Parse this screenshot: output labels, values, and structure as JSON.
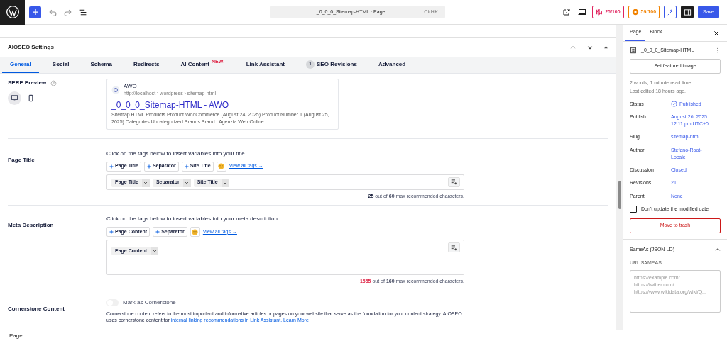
{
  "topbar": {
    "document_title": "_0_0_0_Sitemap-HTML · Page",
    "shortcut": "Ctrl+K",
    "scores": [
      {
        "label": "25/100",
        "color": "#e0245e"
      },
      {
        "label": "59/100",
        "color": "#f18200"
      }
    ],
    "save": "Save"
  },
  "panel": {
    "title": "AIOSEO Settings",
    "tabs": [
      {
        "label": "General",
        "selected": true
      },
      {
        "label": "Social",
        "selected": false
      },
      {
        "label": "Schema",
        "selected": false
      },
      {
        "label": "Redirects",
        "selected": false
      },
      {
        "label": "AI Content",
        "badge": "NEW!",
        "selected": false
      },
      {
        "label": "Link Assistant",
        "selected": false
      },
      {
        "label": "SEO Revisions",
        "count": "1",
        "selected": false
      },
      {
        "label": "Advanced",
        "selected": false
      }
    ],
    "serp": {
      "label": "SERP Preview",
      "devices": [
        {
          "kind": "desktop",
          "selected": true
        },
        {
          "kind": "mobile",
          "selected": false
        }
      ],
      "site": "AWO",
      "url": "http://localhost › wordpress › sitemap-html",
      "title": "_0_0_0_Sitemap-HTML - AWO",
      "description": "Sitemap HTML Products Product WooCommerce (August 24, 2025) Product Number 1 (August 25, 2025) Categories Uncategorized Brands Brand : Agenzia Web Online ..."
    },
    "page_title": {
      "label": "Page Title",
      "hint": "Click on the tags below to insert variables into your title.",
      "add_tags": [
        "Page Title",
        "Separator",
        "Site Title"
      ],
      "view_all": "View all tags →",
      "tokens": [
        "Page Title",
        "Separator",
        "Site Title"
      ],
      "counter": {
        "count": "25",
        "over_limit": false,
        "rest": "out of **60** max recommended characters."
      }
    },
    "meta_description": {
      "label": "Meta Description",
      "hint": "Click on the tags below to insert variables into your meta description.",
      "add_tags": [
        "Page Content",
        "Separator"
      ],
      "view_all": "View all tags →",
      "tokens": [
        "Page Content"
      ],
      "counter": {
        "count": "1555",
        "over_limit": true,
        "rest": "out of **160** max recommended characters."
      }
    },
    "cornerstone": {
      "label": "Cornerstone Content",
      "toggle": {
        "label": "Mark as Cornerstone",
        "on": false
      },
      "text": "Cornerstone content refers to the most important and informative articles or pages on your website that serve as the foundation for your content strategy. AIOSEO uses cornerstone content for",
      "link": "internal linking recommendations in Link Assistant.",
      "learn_more": "Learn More"
    }
  },
  "sidebar": {
    "tabs": [
      {
        "label": "Page",
        "selected": true
      },
      {
        "label": "Block",
        "selected": false
      }
    ],
    "document_title": "_0_0_0_Sitemap-HTML",
    "featured_image": "Set featured image",
    "stats": [
      "2 words, 1 minute read time.",
      "Last edited 18 hours ago."
    ],
    "fields": [
      {
        "label": "Status",
        "value": "Published",
        "kind": "status"
      },
      {
        "label": "Publish",
        "value": "August 26, 2025 12:11 pm UTC+0"
      },
      {
        "label": "Slug",
        "value": "sitemap-html"
      },
      {
        "label": "Author",
        "value": "Stefano-Root-Locale"
      },
      {
        "label": "Discussion",
        "value": "Closed"
      },
      {
        "label": "Revisions",
        "value": "21"
      },
      {
        "label": "Parent",
        "value": "None"
      }
    ],
    "checkbox": {
      "label": "Don't update the modified date",
      "checked": false
    },
    "trash": "Move to trash",
    "sameas": {
      "title": "SameAs (JSON-LD)",
      "expanded": true,
      "field_label": "URL SAMEAS",
      "placeholder": "https://example.com/...\nhttps://twitter.com/...\nhttps://www.wikidata.org/wiki/Q..."
    }
  },
  "status_bar": "Page"
}
